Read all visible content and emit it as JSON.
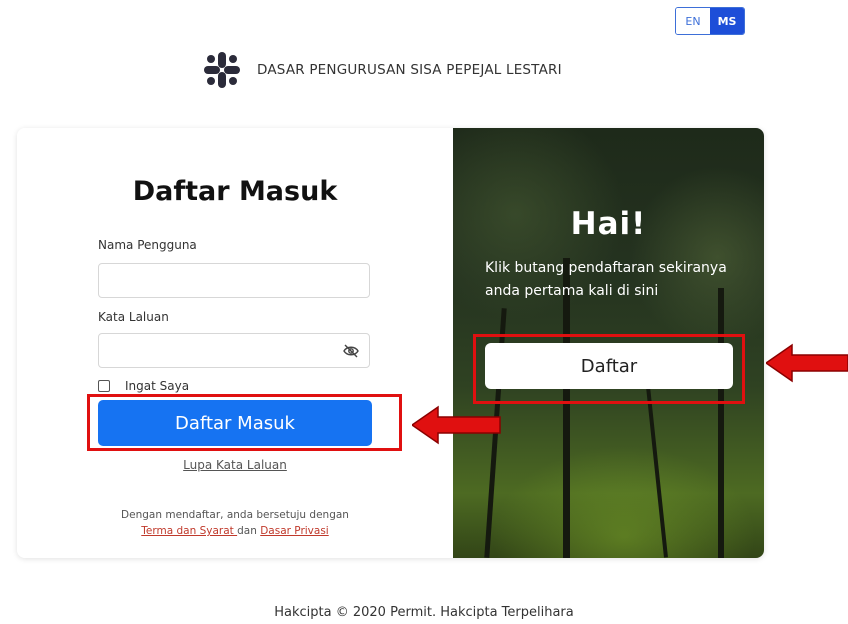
{
  "language": {
    "options": [
      "EN",
      "MS"
    ],
    "active": "MS"
  },
  "brand": {
    "text": "DASAR PENGURUSAN SISA PEPEJAL LESTARI",
    "logo_icon": "slack-like-logo-icon"
  },
  "login": {
    "title": "Daftar Masuk",
    "username_label": "Nama Pengguna",
    "username_value": "",
    "password_label": "Kata Laluan",
    "password_value": "",
    "remember_label": "Ingat Saya",
    "remember_checked": false,
    "submit_label": "Daftar Masuk",
    "forgot_label": "Lupa Kata Laluan",
    "terms_text": "Dengan mendaftar, anda bersetuju dengan",
    "terms_link": "Terma dan Syarat ",
    "terms_and": " dan ",
    "privacy_link": "Dasar Privasi"
  },
  "register": {
    "greeting": "Hai!",
    "description": "Klik butang pendaftaran sekiranya anda pertama kali di sini",
    "button_label": "Daftar"
  },
  "footer": {
    "copyright": "Hakcipta © 2020 Permit. Hakcipta Terpelihara"
  },
  "colors": {
    "primary": "#1673f2",
    "annotation": "#e01010",
    "lang_active": "#1d4ed8"
  }
}
